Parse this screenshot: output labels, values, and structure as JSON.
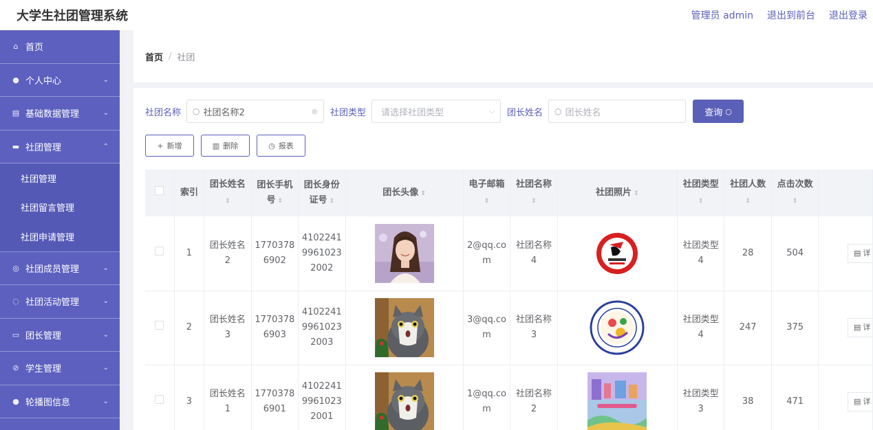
{
  "app_title": "大学生社团管理系统",
  "top_links": {
    "admin": "管理员 admin",
    "front": "退出到前台",
    "logout": "退出登录"
  },
  "sidebar": {
    "items": [
      {
        "label": "首页",
        "icon": "home-icon",
        "glyph": "⌂",
        "expandable": false
      },
      {
        "label": "个人中心",
        "icon": "user-icon",
        "glyph": "●",
        "expandable": true
      },
      {
        "label": "基础数据管理",
        "icon": "data-icon",
        "glyph": "▤",
        "expandable": true
      },
      {
        "label": "社团管理",
        "icon": "monitor-icon",
        "glyph": "▬",
        "expandable": true,
        "expanded": true,
        "children": [
          "社团管理",
          "社团留言管理",
          "社团申请管理"
        ]
      },
      {
        "label": "社团成员管理",
        "icon": "compass-icon",
        "glyph": "◎",
        "expandable": true
      },
      {
        "label": "社团活动管理",
        "icon": "power-icon",
        "glyph": "◌",
        "expandable": true
      },
      {
        "label": "团长管理",
        "icon": "briefcase-icon",
        "glyph": "▭",
        "expandable": true
      },
      {
        "label": "学生管理",
        "icon": "compass-icon",
        "glyph": "⊘",
        "expandable": true
      },
      {
        "label": "轮播图信息",
        "icon": "user-icon",
        "glyph": "●",
        "expandable": true
      }
    ]
  },
  "breadcrumb": {
    "home": "首页",
    "sep": "/",
    "current": "社团"
  },
  "filters": {
    "name_label": "社团名称",
    "name_value": "社团名称2",
    "type_label": "社团类型",
    "type_placeholder": "请选择社团类型",
    "leader_label": "团长姓名",
    "leader_placeholder": "团长姓名",
    "query_label": "查询"
  },
  "actions": {
    "add": "新增",
    "delete": "删除",
    "report": "报表"
  },
  "table": {
    "headers": [
      "索引",
      "团长姓名",
      "团长手机号",
      "团长身份证号",
      "团长头像",
      "电子邮箱",
      "社团名称",
      "社团照片",
      "社团类型",
      "社团人数",
      "点击次数"
    ],
    "detail_label": "详",
    "rows": [
      {
        "index": "1",
        "leader": "团长姓名2",
        "phone": "17703786902",
        "id_no": "410224199610232002",
        "avatar": "girl-photo",
        "email": "2@qq.com",
        "club": "社团名称4",
        "photo": "red-circle-logo",
        "type": "社团类型4",
        "members": "28",
        "clicks": "504"
      },
      {
        "index": "2",
        "leader": "团长姓名3",
        "phone": "17703786903",
        "id_no": "410224199610232003",
        "avatar": "cat-photo",
        "email": "3@qq.com",
        "club": "社团名称3",
        "photo": "school-of-software-logo",
        "type": "社团类型4",
        "members": "247",
        "clicks": "375"
      },
      {
        "index": "3",
        "leader": "团长姓名1",
        "phone": "17703786901",
        "id_no": "410224199610232001",
        "avatar": "cat-photo",
        "email": "1@qq.com",
        "club": "社团名称2",
        "photo": "join-us-poster",
        "type": "社团类型3",
        "members": "38",
        "clicks": "471"
      }
    ]
  },
  "colors": {
    "primary": "#5a5fb8",
    "sidebar": "#5d60bf",
    "header_bg": "#f2f3f7"
  }
}
